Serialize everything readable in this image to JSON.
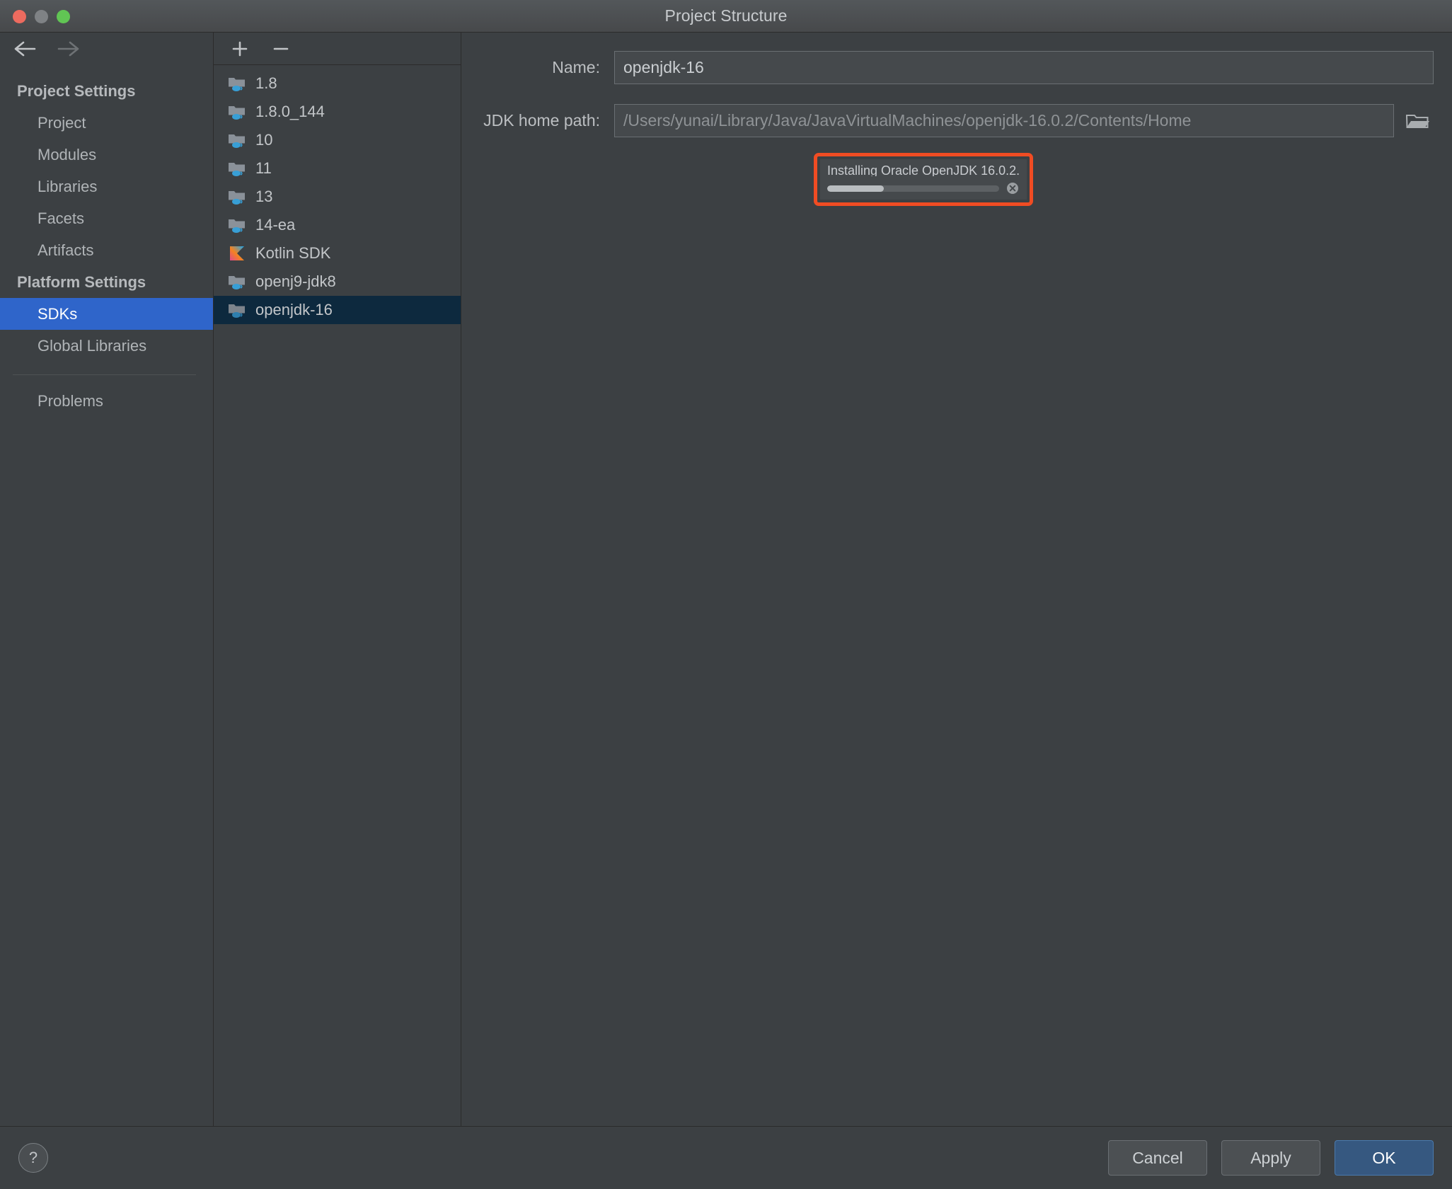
{
  "window": {
    "title": "Project Structure",
    "traffic_lights": [
      "close",
      "minimize",
      "zoom"
    ]
  },
  "nav": {
    "back_icon": "arrow-left-icon",
    "forward_icon": "arrow-right-icon"
  },
  "sidebar": {
    "groups": [
      {
        "label": "Project Settings",
        "items": [
          {
            "label": "Project",
            "selected": false
          },
          {
            "label": "Modules",
            "selected": false
          },
          {
            "label": "Libraries",
            "selected": false
          },
          {
            "label": "Facets",
            "selected": false
          },
          {
            "label": "Artifacts",
            "selected": false
          }
        ]
      },
      {
        "label": "Platform Settings",
        "items": [
          {
            "label": "SDKs",
            "selected": true
          },
          {
            "label": "Global Libraries",
            "selected": false
          }
        ]
      }
    ],
    "extra_items": [
      {
        "label": "Problems",
        "selected": false
      }
    ]
  },
  "sdk_toolbar": {
    "add_label": "+",
    "remove_label": "–"
  },
  "sdk_list": {
    "items": [
      {
        "label": "1.8",
        "icon": "jdk-folder-icon",
        "selected": false
      },
      {
        "label": "1.8.0_144",
        "icon": "jdk-folder-icon",
        "selected": false
      },
      {
        "label": "10",
        "icon": "jdk-folder-icon",
        "selected": false
      },
      {
        "label": "11",
        "icon": "jdk-folder-icon",
        "selected": false
      },
      {
        "label": "13",
        "icon": "jdk-folder-icon",
        "selected": false
      },
      {
        "label": "14-ea",
        "icon": "jdk-folder-icon",
        "selected": false
      },
      {
        "label": "Kotlin SDK",
        "icon": "kotlin-sdk-icon",
        "selected": false
      },
      {
        "label": "openj9-jdk8",
        "icon": "jdk-folder-icon",
        "selected": false
      },
      {
        "label": "openjdk-16",
        "icon": "jdk-folder-icon",
        "selected": true
      }
    ]
  },
  "detail": {
    "name_label": "Name:",
    "name_value": "openjdk-16",
    "path_label": "JDK home path:",
    "path_value": "/Users/yunai/Library/Java/JavaVirtualMachines/openjdk-16.0.2/Contents/Home",
    "browse_icon": "folder-browse-icon"
  },
  "progress": {
    "text": "Installing Oracle OpenJDK 16.0.2...",
    "percent": 33,
    "cancel_icon": "cancel-circle-icon",
    "highlight_color": "#f04c23"
  },
  "footer": {
    "help_label": "?",
    "cancel_label": "Cancel",
    "apply_label": "Apply",
    "ok_label": "OK",
    "ok_color": "#365880"
  }
}
